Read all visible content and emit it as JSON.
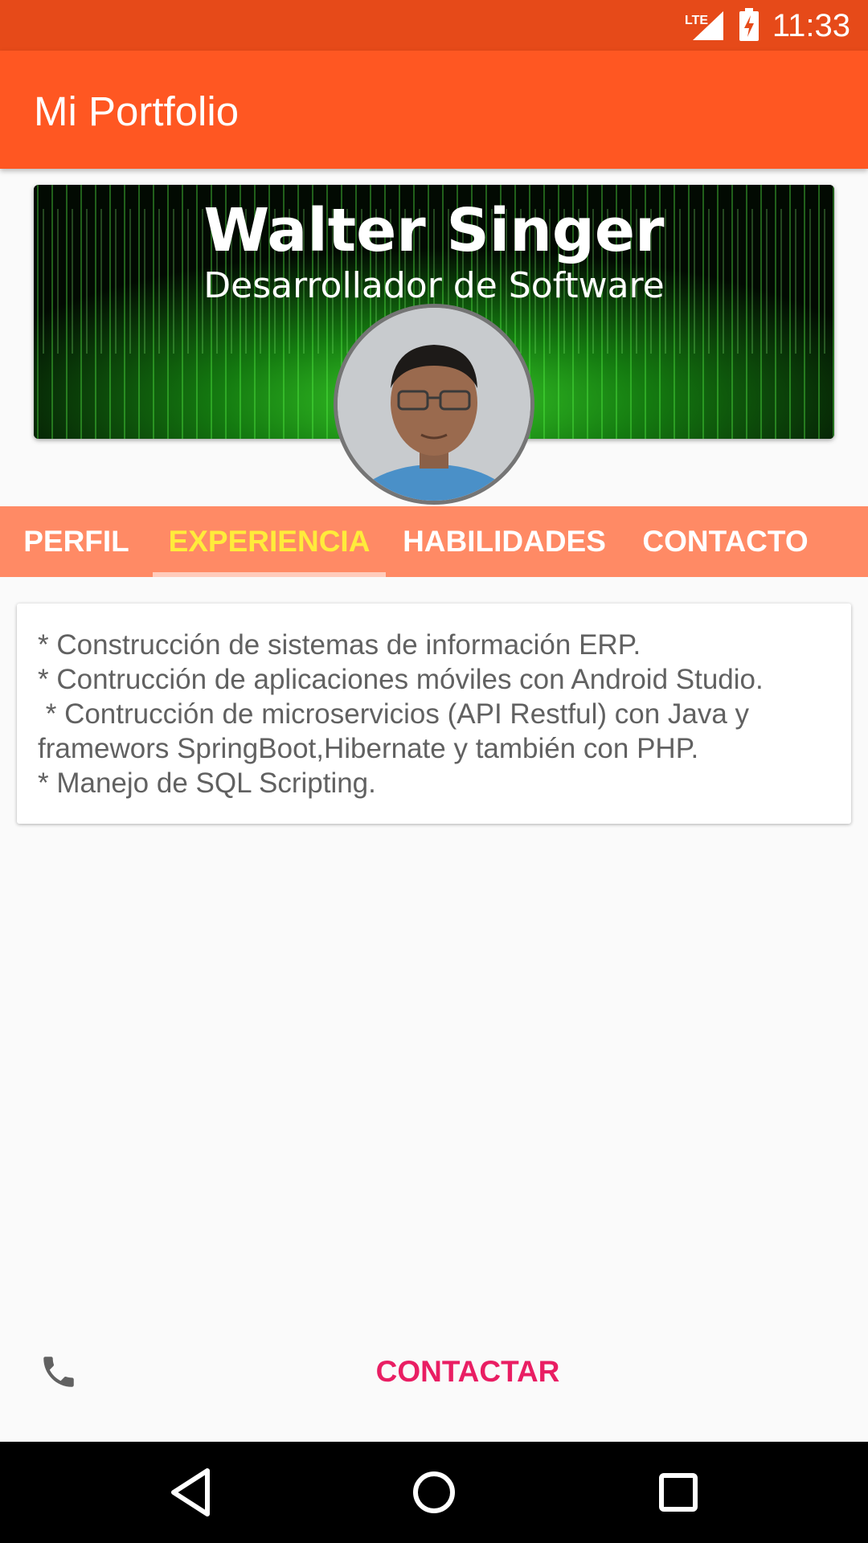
{
  "status_bar": {
    "time": "11:33",
    "network_label": "LTE",
    "icons": [
      "lte-signal-icon",
      "battery-charging-icon"
    ]
  },
  "app_bar": {
    "title": "Mi Portfolio"
  },
  "header": {
    "name": "Walter Singer",
    "role": "Desarrollador de Software"
  },
  "tabs": [
    {
      "label": "PERFIL",
      "active": false
    },
    {
      "label": "EXPERIENCIA",
      "active": true
    },
    {
      "label": "HABILIDADES",
      "active": false
    },
    {
      "label": "CONTACTO",
      "active": false
    }
  ],
  "experience": {
    "lines": [
      "* Construcción de sistemas de información ERP.",
      "* Contrucción de aplicaciones móviles con Android Studio.",
      " * Contrucción de microservicios (API Restful) con Java y",
      "framewors SpringBoot,Hibernate y también con PHP.",
      "* Manejo de SQL Scripting."
    ]
  },
  "contact": {
    "button_label": "CONTACTAR",
    "icon": "phone-icon"
  },
  "colors": {
    "status_bar": "#e64a19",
    "app_bar": "#ff5722",
    "tab_bar": "#ff8a65",
    "active_tab": "#ffeb3b",
    "accent": "#e91e63"
  },
  "nav_bar": {
    "icons": [
      "back-icon",
      "home-icon",
      "recents-icon"
    ]
  }
}
